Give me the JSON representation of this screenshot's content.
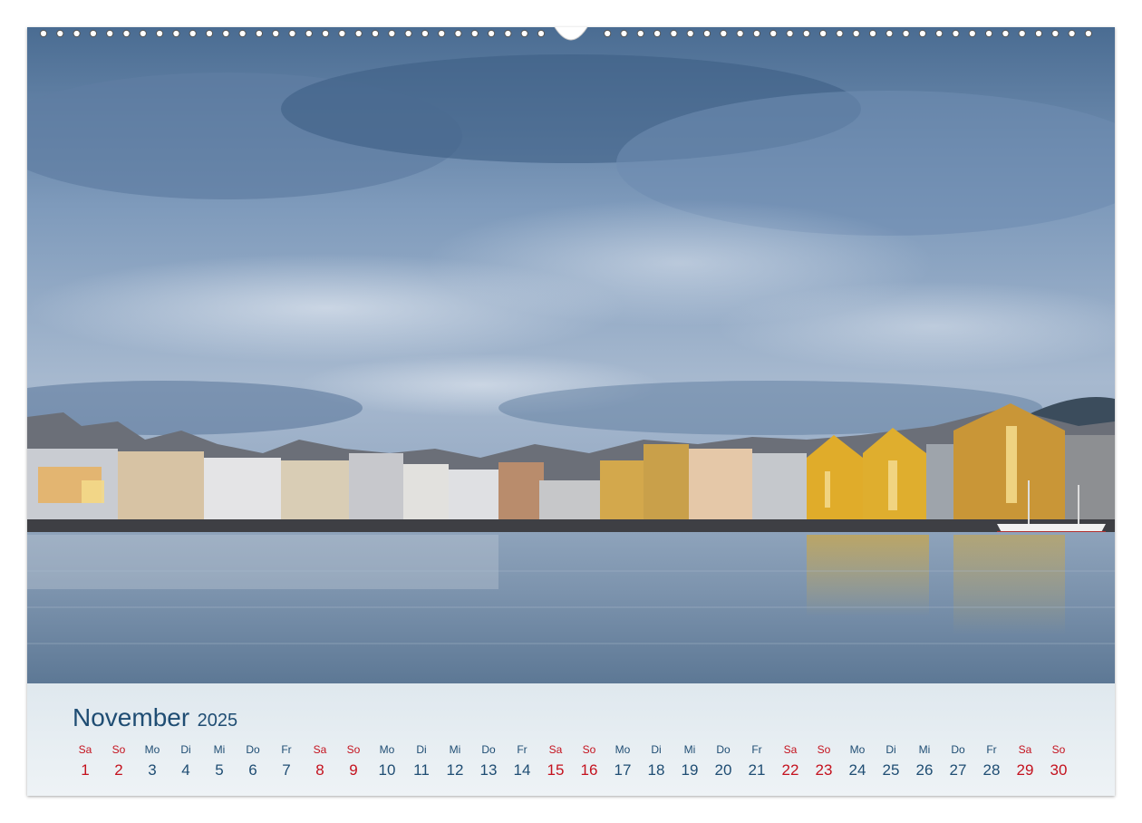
{
  "calendar": {
    "month": "November",
    "year": "2025",
    "days": [
      {
        "dow": "Sa",
        "num": "1",
        "weekend": true
      },
      {
        "dow": "So",
        "num": "2",
        "weekend": true
      },
      {
        "dow": "Mo",
        "num": "3",
        "weekend": false
      },
      {
        "dow": "Di",
        "num": "4",
        "weekend": false
      },
      {
        "dow": "Mi",
        "num": "5",
        "weekend": false
      },
      {
        "dow": "Do",
        "num": "6",
        "weekend": false
      },
      {
        "dow": "Fr",
        "num": "7",
        "weekend": false
      },
      {
        "dow": "Sa",
        "num": "8",
        "weekend": true
      },
      {
        "dow": "So",
        "num": "9",
        "weekend": true
      },
      {
        "dow": "Mo",
        "num": "10",
        "weekend": false
      },
      {
        "dow": "Di",
        "num": "11",
        "weekend": false
      },
      {
        "dow": "Mi",
        "num": "12",
        "weekend": false
      },
      {
        "dow": "Do",
        "num": "13",
        "weekend": false
      },
      {
        "dow": "Fr",
        "num": "14",
        "weekend": false
      },
      {
        "dow": "Sa",
        "num": "15",
        "weekend": true
      },
      {
        "dow": "So",
        "num": "16",
        "weekend": true
      },
      {
        "dow": "Mo",
        "num": "17",
        "weekend": false
      },
      {
        "dow": "Di",
        "num": "18",
        "weekend": false
      },
      {
        "dow": "Mi",
        "num": "19",
        "weekend": false
      },
      {
        "dow": "Do",
        "num": "20",
        "weekend": false
      },
      {
        "dow": "Fr",
        "num": "21",
        "weekend": false
      },
      {
        "dow": "Sa",
        "num": "22",
        "weekend": true
      },
      {
        "dow": "So",
        "num": "23",
        "weekend": true
      },
      {
        "dow": "Mo",
        "num": "24",
        "weekend": false
      },
      {
        "dow": "Di",
        "num": "25",
        "weekend": false
      },
      {
        "dow": "Mi",
        "num": "26",
        "weekend": false
      },
      {
        "dow": "Do",
        "num": "27",
        "weekend": false
      },
      {
        "dow": "Fr",
        "num": "28",
        "weekend": false
      },
      {
        "dow": "Sa",
        "num": "29",
        "weekend": true
      },
      {
        "dow": "So",
        "num": "30",
        "weekend": true
      }
    ]
  },
  "colors": {
    "title": "#1f4d73",
    "weekday": "#1f4d73",
    "weekend": "#c4121e",
    "footer_bg": "#e6eef3"
  }
}
